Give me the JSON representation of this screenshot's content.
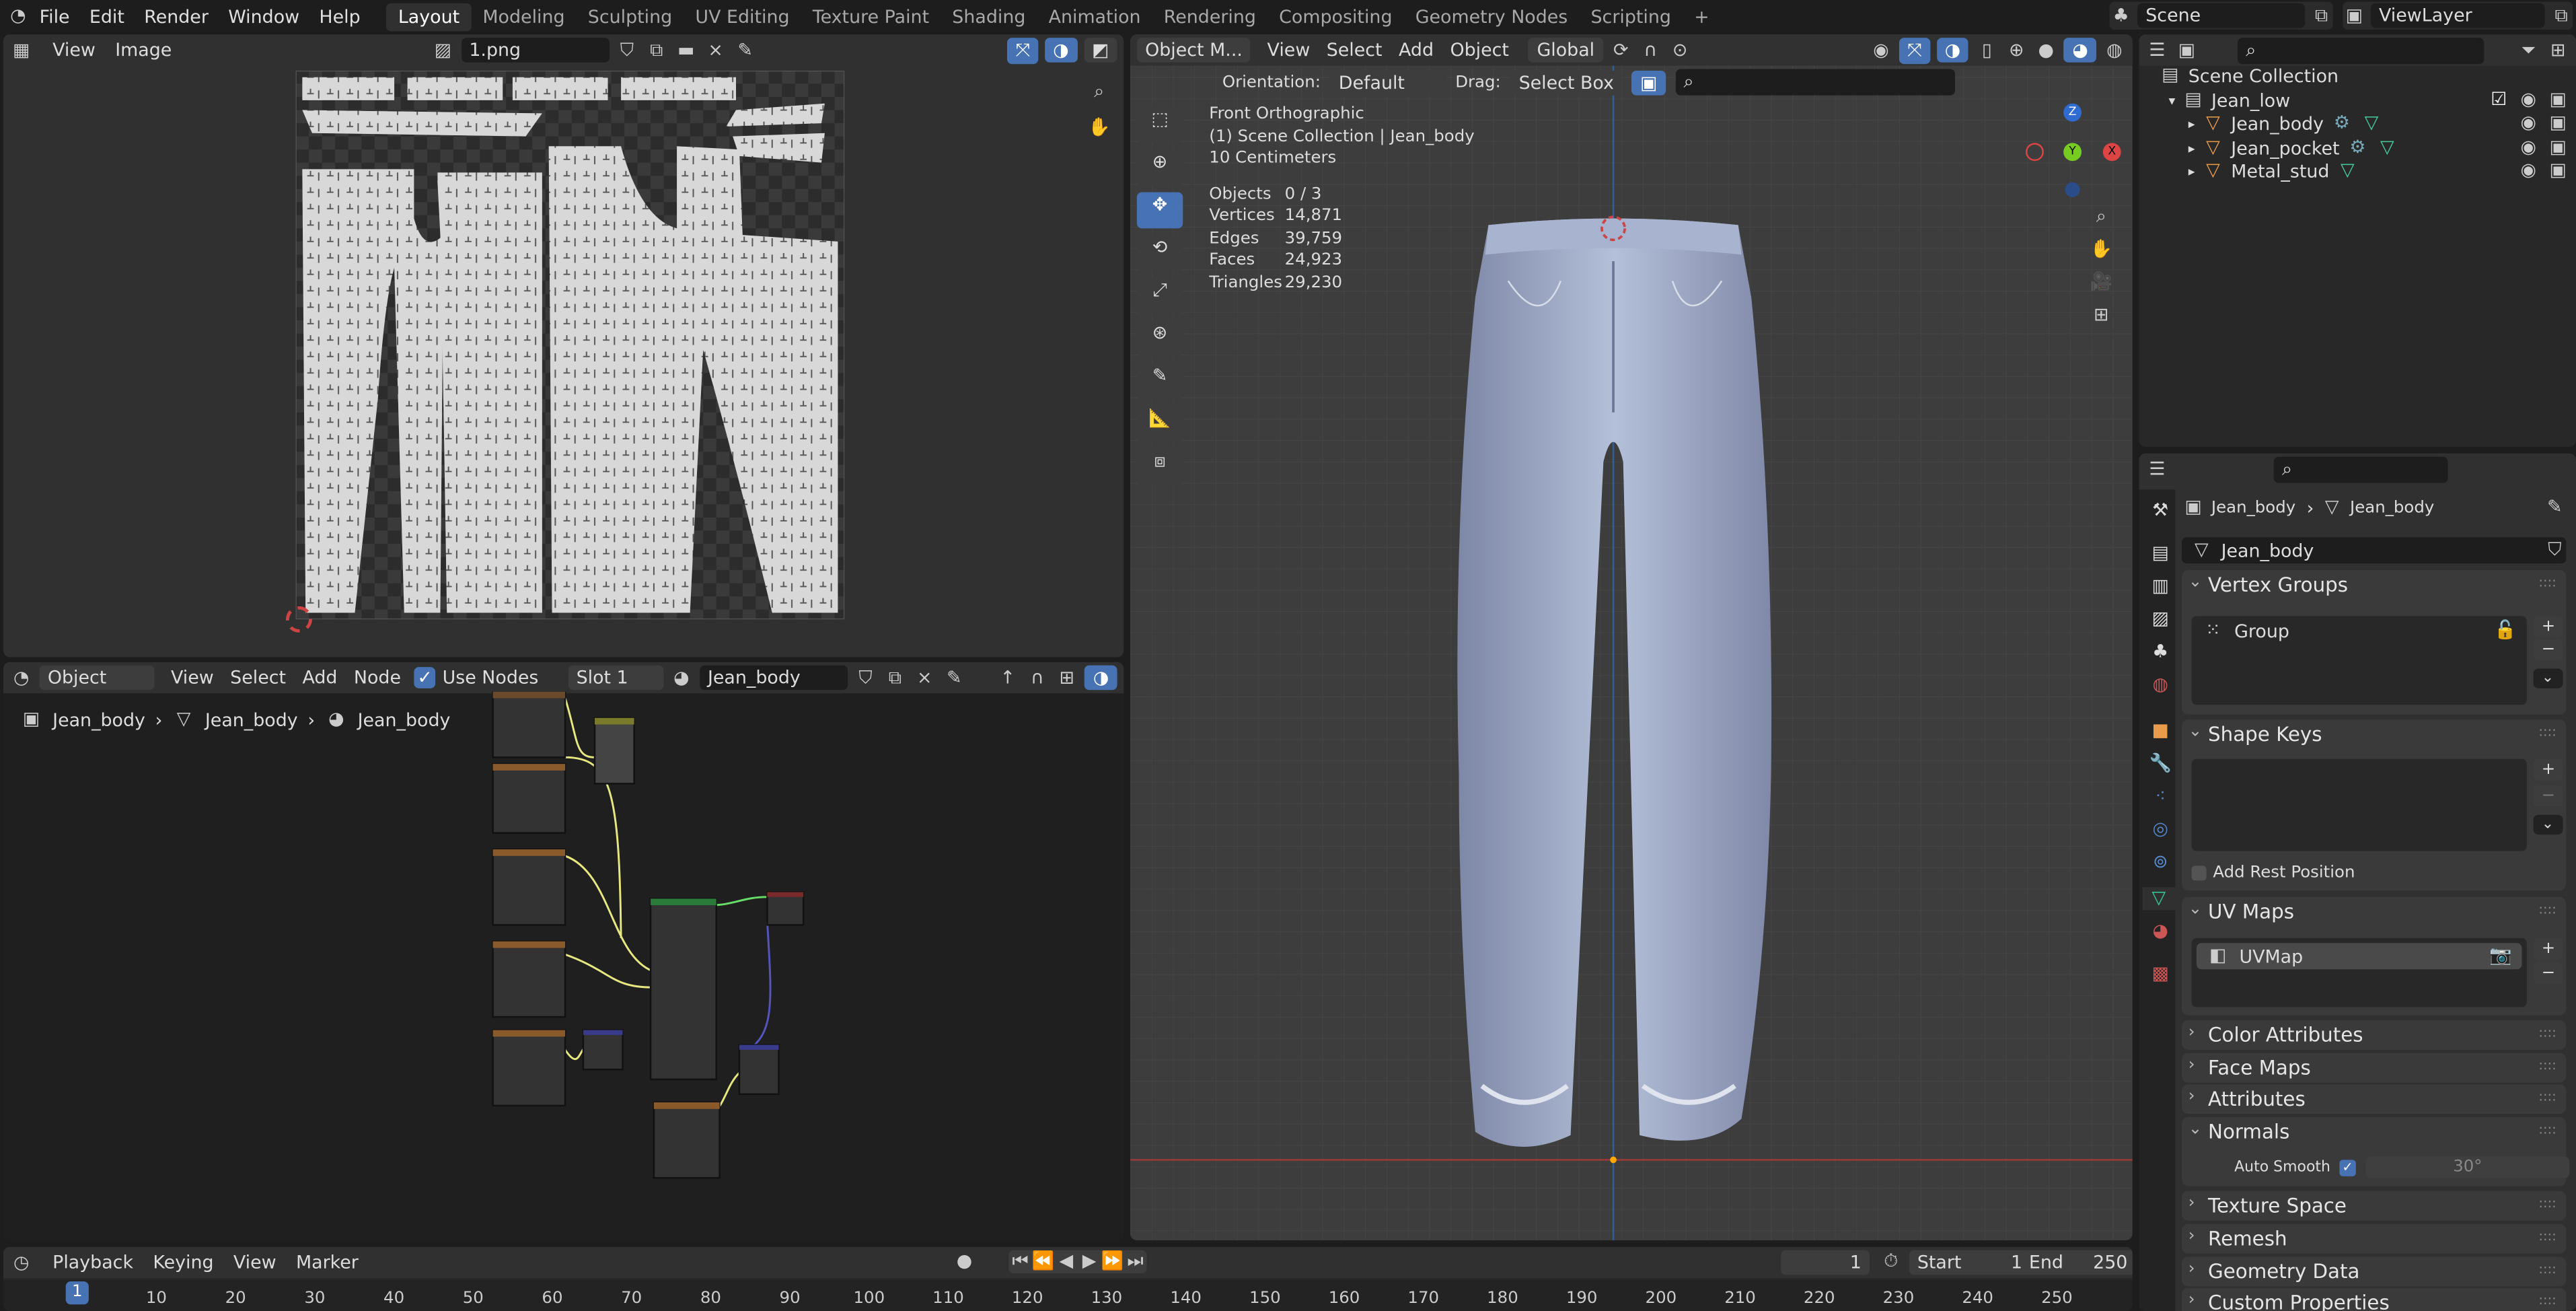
{
  "topbar": {
    "menus": [
      "File",
      "Edit",
      "Render",
      "Window",
      "Help"
    ],
    "workspaces": [
      "Layout",
      "Modeling",
      "Sculpting",
      "UV Editing",
      "Texture Paint",
      "Shading",
      "Animation",
      "Rendering",
      "Compositing",
      "Geometry Nodes",
      "Scripting"
    ],
    "add": "+",
    "scene": "Scene",
    "view_layer": "ViewLayer"
  },
  "image_editor": {
    "menus": [
      "View",
      "Image"
    ],
    "image_name": "1.png"
  },
  "node_editor": {
    "object_mode": "Object",
    "menus": [
      "View",
      "Select",
      "Add",
      "Node"
    ],
    "use_nodes_label": "Use Nodes",
    "use_nodes": true,
    "slot": "Slot 1",
    "material": "Jean_body",
    "breadcrumb": [
      "Jean_body",
      "Jean_body",
      "Jean_body"
    ]
  },
  "viewport": {
    "mode": "Object M...",
    "menus": [
      "View",
      "Select",
      "Add",
      "Object"
    ],
    "transform_orientation": "Global",
    "orientation_label": "Orientation:",
    "orientation": "Default",
    "drag_label": "Drag:",
    "drag": "Select Box",
    "overlay": {
      "view": "Front Orthographic",
      "collection": "(1) Scene Collection | Jean_body",
      "scale": "10 Centimeters"
    },
    "stats": [
      {
        "label": "Objects",
        "value": "0 / 3"
      },
      {
        "label": "Vertices",
        "value": "14,871"
      },
      {
        "label": "Edges",
        "value": "39,759"
      },
      {
        "label": "Faces",
        "value": "24,923"
      },
      {
        "label": "Triangles",
        "value": "29,230"
      }
    ],
    "gizmo": {
      "x": "X",
      "y": "Y",
      "z": "Z"
    }
  },
  "outliner": {
    "root": "Scene Collection",
    "items": [
      {
        "name": "Jean_low"
      },
      {
        "name": "Jean_body"
      },
      {
        "name": "Jean_pocket"
      },
      {
        "name": "Metal_stud"
      }
    ]
  },
  "properties": {
    "breadcrumb_object": "Jean_body",
    "breadcrumb_mesh": "Jean_body",
    "mesh_name": "Jean_body",
    "vertex_groups": {
      "title": "Vertex Groups",
      "items": [
        "Group"
      ]
    },
    "shape_keys": {
      "title": "Shape Keys",
      "add_rest_position": "Add Rest Position"
    },
    "uv_maps": {
      "title": "UV Maps",
      "items": [
        "UVMap"
      ]
    },
    "collapsed_panels": [
      "Color Attributes",
      "Face Maps",
      "Attributes"
    ],
    "normals": {
      "title": "Normals",
      "auto_smooth_label": "Auto Smooth",
      "auto_smooth": true,
      "angle": "30°"
    },
    "more_panels": [
      "Texture Space",
      "Remesh",
      "Geometry Data",
      "Custom Properties"
    ]
  },
  "timeline": {
    "menus": [
      "Playback",
      "Keying",
      "View",
      "Marker"
    ],
    "current_frame": "1",
    "start_label": "Start",
    "start": "1",
    "end_label": "End",
    "end": "250",
    "ticks": [
      "10",
      "20",
      "30",
      "40",
      "50",
      "60",
      "70",
      "80",
      "90",
      "100",
      "110",
      "120",
      "130",
      "140",
      "150",
      "160",
      "170",
      "180",
      "190",
      "200",
      "210",
      "220",
      "230",
      "240",
      "250"
    ],
    "playhead": "1"
  },
  "colors": {
    "accent": "#4772b3",
    "background": "#1d1d1d",
    "header": "#303030",
    "area": "#282828"
  }
}
